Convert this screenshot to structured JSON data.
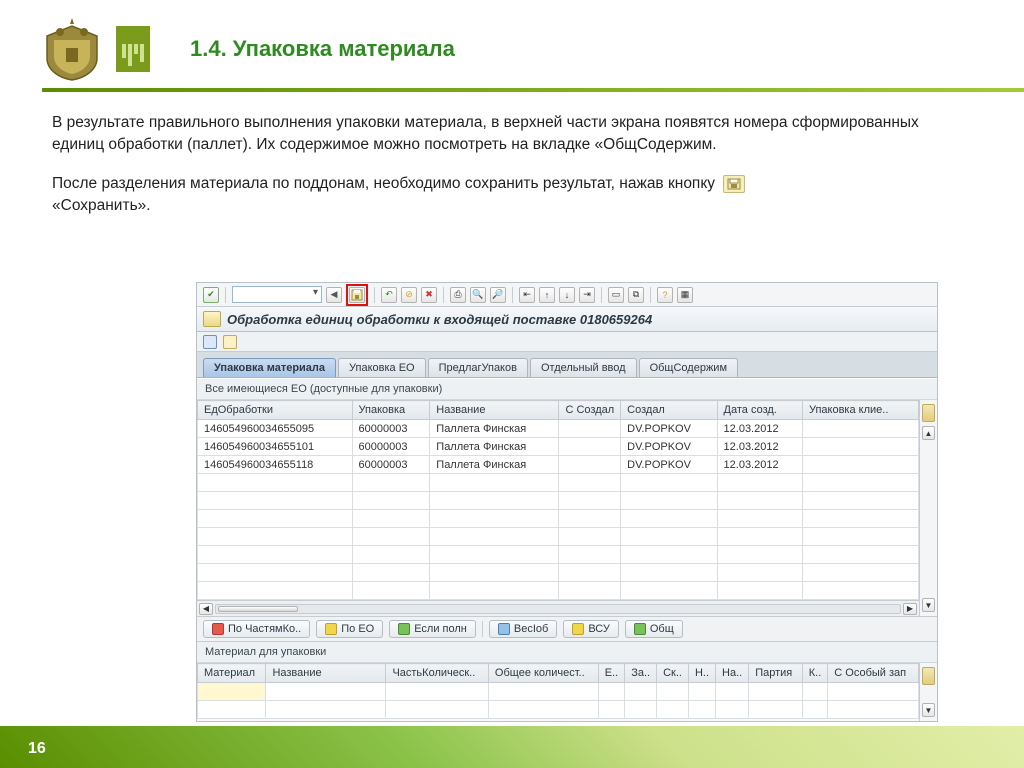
{
  "page": {
    "number": "16",
    "title": "1.4. Упаковка материала"
  },
  "body": {
    "p1": "В результате правильного выполнения упаковки материала, в верхней части экрана появятся номера сформированных единиц обработки (паллет). Их содержимое можно посмотреть на вкладке «ОбщСодержим.",
    "p2a": "После разделения материала по поддонам, необходимо сохранить результат, нажав кнопку ",
    "p2b": "«Сохранить»."
  },
  "sap": {
    "window_title": "Обработка единиц обработки к входящей поставке 0180659264",
    "tabs": [
      "Упаковка материала",
      "Упаковка ЕО",
      "ПредлагУпаков",
      "Отдельный ввод",
      "ОбщСодержим"
    ],
    "subheader": "Все имеющиеся ЕО (доступные для упаковки)",
    "columns": [
      "ЕдОбработки",
      "Упаковка",
      "Название",
      "С Создал",
      "Дата созд.",
      "Упаковка клие.."
    ],
    "rows": [
      {
        "id": "146054960034655095",
        "pack": "60000003",
        "name": "Паллета Финская",
        "cflag": "",
        "by": "DV.POPKOV",
        "date": "12.03.2012",
        "cust": ""
      },
      {
        "id": "146054960034655101",
        "pack": "60000003",
        "name": "Паллета Финская",
        "cflag": "",
        "by": "DV.POPKOV",
        "date": "12.03.2012",
        "cust": ""
      },
      {
        "id": "146054960034655118",
        "pack": "60000003",
        "name": "Паллета Финская",
        "cflag": "",
        "by": "DV.POPKOV",
        "date": "12.03.2012",
        "cust": ""
      }
    ],
    "buttons": {
      "parts": "По ЧастямКо..",
      "eo": "По ЕО",
      "full": "Если полн",
      "weight": "ВесІоб",
      "vsu": "ВСУ",
      "total": "Общ"
    },
    "lower_header": "Материал для упаковки",
    "lower_columns": [
      "Материал",
      "Название",
      "ЧастьКолическ..",
      "Общее количест..",
      "Е..",
      "За..",
      "Ск..",
      "Н..",
      "На..",
      "Партия",
      "К..",
      "С Особый зап"
    ]
  }
}
